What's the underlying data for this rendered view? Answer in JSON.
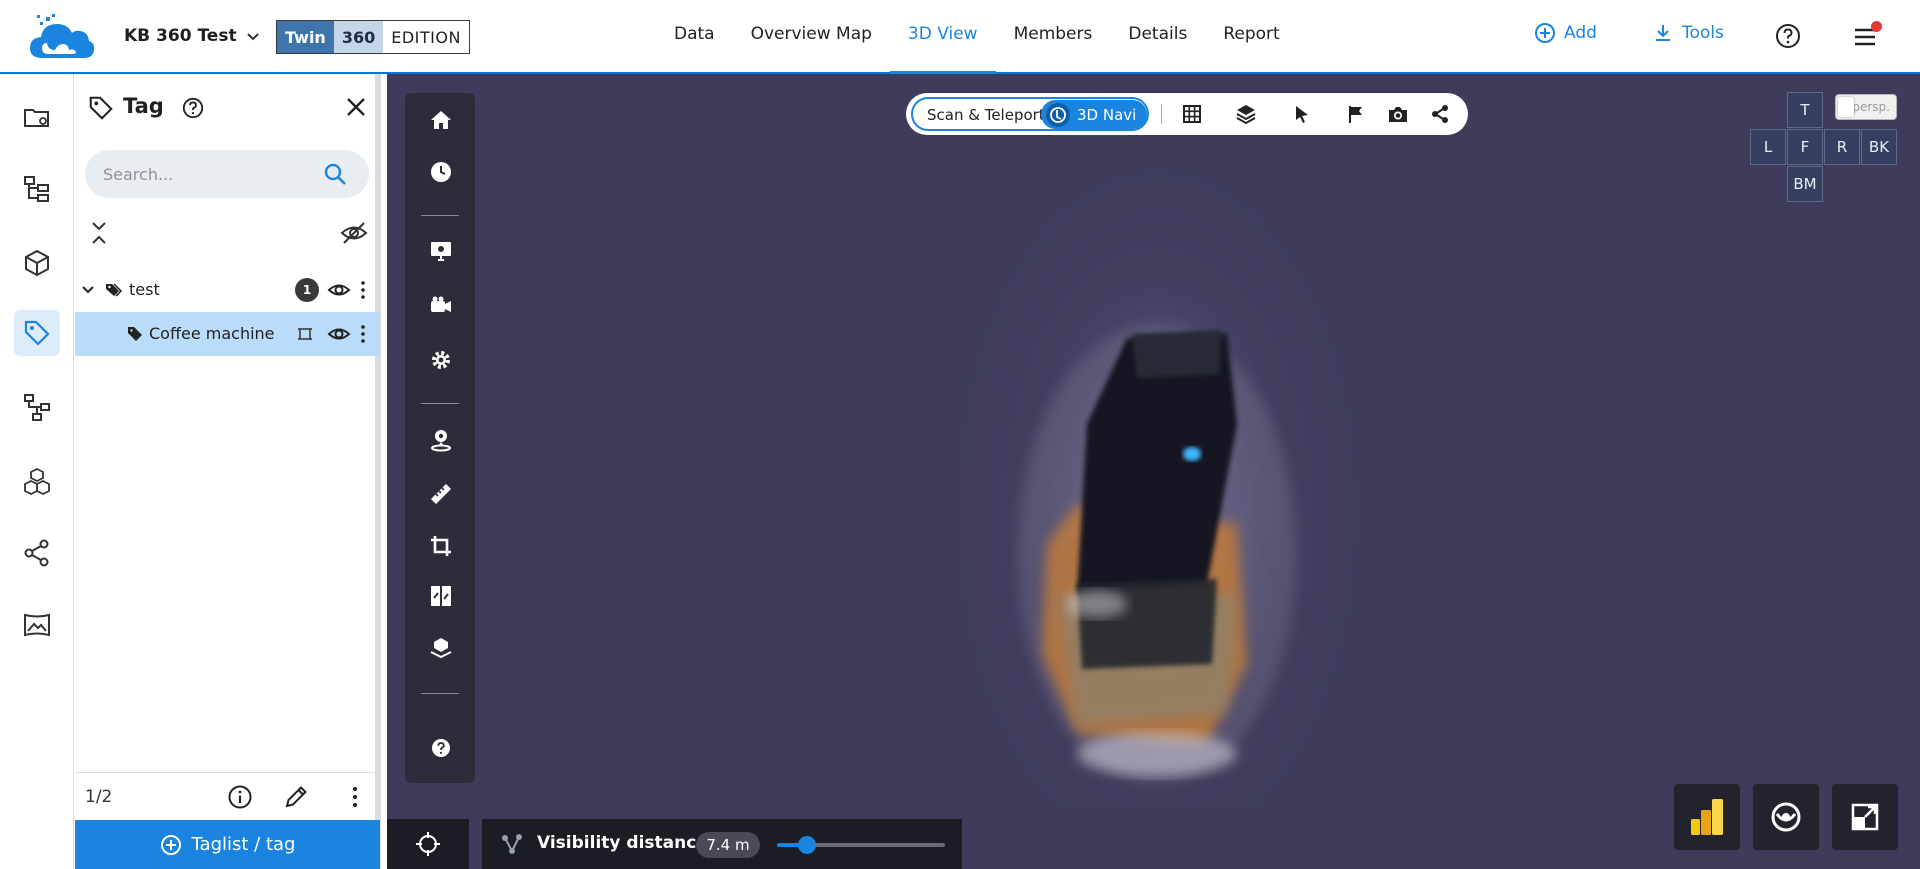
{
  "header": {
    "project_name": "KB 360 Test",
    "edition": {
      "twin": "Twin",
      "num": "360",
      "label": "EDITION"
    },
    "nav": [
      {
        "label": "Data"
      },
      {
        "label": "Overview Map"
      },
      {
        "label": "3D View",
        "active": true
      },
      {
        "label": "Members"
      },
      {
        "label": "Details"
      },
      {
        "label": "Report"
      }
    ],
    "add_label": "Add",
    "tools_label": "Tools",
    "accent_color": "#1a84de"
  },
  "tag_panel": {
    "title": "Tag",
    "search_placeholder": "Search...",
    "tree": [
      {
        "label": "test",
        "count": "1"
      },
      {
        "label": "Coffee machine"
      }
    ],
    "pager": "1/2",
    "taglist_button": "Taglist / tag"
  },
  "viewer": {
    "mode_scan": "Scan & Teleport",
    "mode_navi": "3D Navi",
    "view_cube": {
      "top": "T",
      "left": "L",
      "front": "F",
      "right": "R",
      "back": "BK",
      "bottom": "BM"
    },
    "projection": "persp.",
    "visibility_label": "Visibility distance",
    "visibility_value": "7.4 m",
    "visibility_fraction": 0.18
  }
}
